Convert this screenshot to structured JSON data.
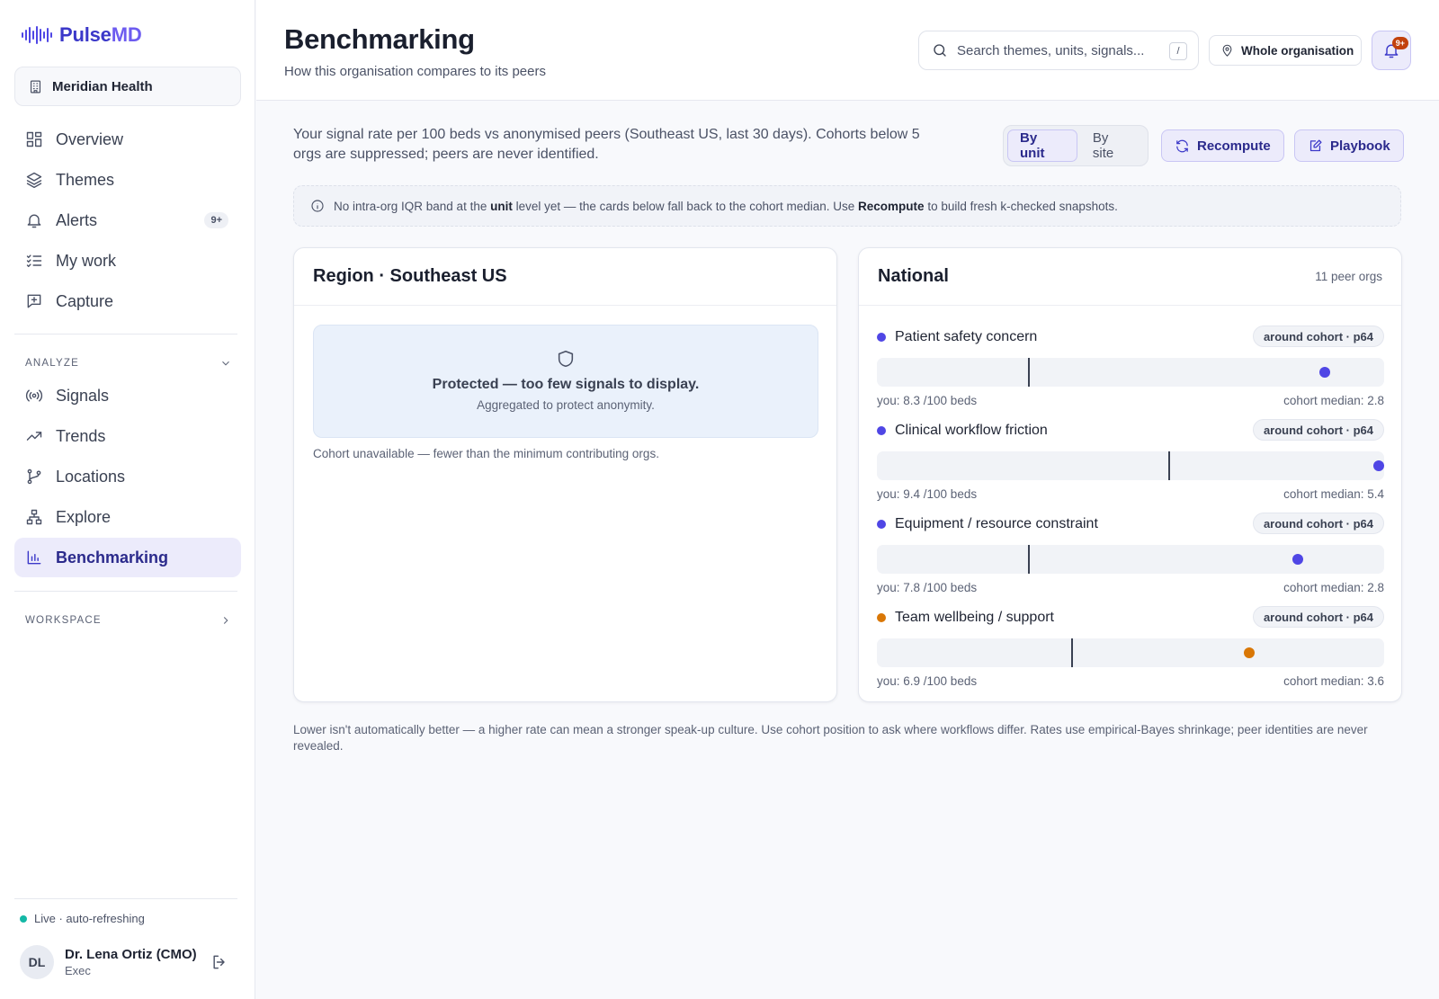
{
  "brand": {
    "name_a": "Pulse",
    "name_b": "MD"
  },
  "org": {
    "name": "Meridian Health"
  },
  "nav": {
    "primary": [
      {
        "label": "Overview",
        "icon": "grid-icon"
      },
      {
        "label": "Themes",
        "icon": "layers-icon"
      },
      {
        "label": "Alerts",
        "icon": "bell-icon",
        "badge": "9+"
      },
      {
        "label": "My work",
        "icon": "checklist-icon"
      },
      {
        "label": "Capture",
        "icon": "message-plus-icon"
      }
    ],
    "analyze_label": "ANALYZE",
    "analyze": [
      {
        "label": "Signals",
        "icon": "broadcast-icon"
      },
      {
        "label": "Trends",
        "icon": "trending-up-icon"
      },
      {
        "label": "Locations",
        "icon": "git-branch-icon"
      },
      {
        "label": "Explore",
        "icon": "sitemap-icon"
      },
      {
        "label": "Benchmarking",
        "icon": "bar-chart-icon",
        "active": true
      }
    ],
    "workspace_label": "WORKSPACE"
  },
  "status": {
    "live": "Live · auto-refreshing"
  },
  "user": {
    "initials": "DL",
    "name": "Dr. Lena Ortiz (CMO)",
    "role": "Exec"
  },
  "header": {
    "title": "Benchmarking",
    "subtitle": "How this organisation compares to its peers",
    "search_placeholder": "Search themes, units, signals...",
    "search_shortcut": "/",
    "scope": "Whole organisation",
    "notifications_badge": "9+"
  },
  "intro": "Your signal rate per 100 beds vs anonymised peers (Southeast US, last 30 days). Cohorts below 5 orgs are suppressed; peers are never identified.",
  "view_toggle": {
    "by_unit": "By unit",
    "by_site": "By site",
    "selected": "By unit"
  },
  "actions": {
    "recompute": "Recompute",
    "playbook": "Playbook"
  },
  "notice": {
    "part1": "No intra-org IQR band at the ",
    "bold1": "unit",
    "part2": " level yet — the cards below fall back to the cohort median. Use ",
    "bold2": "Recompute",
    "part3": " to build fresh k-checked snapshots."
  },
  "region_card": {
    "title": "Region · Southeast US",
    "protected_title": "Protected — too few signals to display.",
    "protected_sub": "Aggregated to protect anonymity.",
    "cohort_note": "Cohort unavailable — fewer than the minimum contributing orgs."
  },
  "national_card": {
    "title": "National",
    "meta": "11 peer orgs",
    "themes": [
      {
        "name": "Patient safety concern",
        "chip": "around cohort · p64",
        "you": "you: 8.3 /100 beds",
        "median": "cohort median: 2.8",
        "you_value": 8.3,
        "median_value": 2.8,
        "color": "#4f46e5"
      },
      {
        "name": "Clinical workflow friction",
        "chip": "around cohort · p64",
        "you": "you: 9.4 /100 beds",
        "median": "cohort median: 5.4",
        "you_value": 9.4,
        "median_value": 5.4,
        "color": "#4f46e5"
      },
      {
        "name": "Equipment / resource constraint",
        "chip": "around cohort · p64",
        "you": "you: 7.8 /100 beds",
        "median": "cohort median: 2.8",
        "you_value": 7.8,
        "median_value": 2.8,
        "color": "#4f46e5"
      },
      {
        "name": "Team wellbeing / support",
        "chip": "around cohort · p64",
        "you": "you: 6.9 /100 beds",
        "median": "cohort median: 3.6",
        "you_value": 6.9,
        "median_value": 3.6,
        "color": "#d97706"
      }
    ],
    "scale_max": 9.4
  },
  "footnote": "Lower isn't automatically better — a higher rate can mean a stronger speak-up culture. Use cohort position to ask where workflows differ. Rates use empirical-Bayes shrinkage; peer identities are never revealed."
}
